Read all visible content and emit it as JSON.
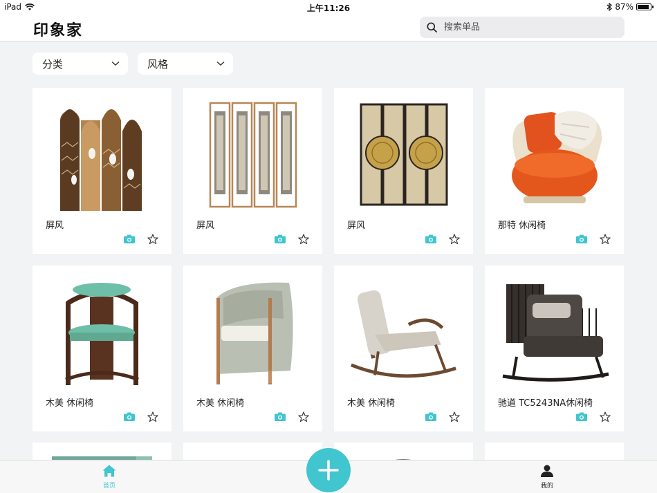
{
  "status": {
    "device": "iPad",
    "time": "上午11:26",
    "battery": "87%",
    "battery_level": 0.87
  },
  "header": {
    "logo": "印象家",
    "search_placeholder": "搜索单品"
  },
  "filters": [
    {
      "label": "分类"
    },
    {
      "label": "风格"
    }
  ],
  "products": [
    {
      "name": "屏风",
      "image": "folding-screen-cranes"
    },
    {
      "name": "屏风",
      "image": "folding-screen-bronze-frame"
    },
    {
      "name": "屏风",
      "image": "folding-screen-gold-medallion"
    },
    {
      "name": "那特 休闲椅",
      "image": "orange-lounge-chair"
    },
    {
      "name": "木美 休闲椅",
      "image": "teal-wooden-armchair"
    },
    {
      "name": "木美 休闲椅",
      "image": "grey-tub-armchair"
    },
    {
      "name": "木美 休闲椅",
      "image": "wooden-rocking-chair"
    },
    {
      "name": "驰道 TC5243NA休闲椅",
      "image": "dark-rocking-chair"
    }
  ],
  "tabbar": {
    "home": "首页",
    "mine": "我的"
  },
  "colors": {
    "accent": "#41c5cf",
    "background": "#f2f3f5"
  },
  "icons": {
    "camera": "camera-icon",
    "favorite": "star-outline-icon",
    "add": "plus-icon"
  }
}
